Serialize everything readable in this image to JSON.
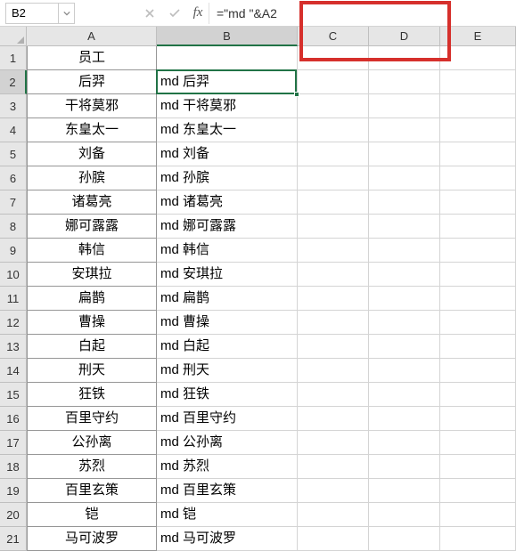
{
  "nameBox": {
    "value": "B2"
  },
  "formulaBar": {
    "fx_label": "fx",
    "formula": "=\"md \"&A2"
  },
  "columns": [
    "A",
    "B",
    "C",
    "D",
    "E"
  ],
  "selected": {
    "col": "B",
    "row": 2
  },
  "rows": [
    {
      "n": 1,
      "a": "员工",
      "b": ""
    },
    {
      "n": 2,
      "a": "后羿",
      "b": "md 后羿"
    },
    {
      "n": 3,
      "a": "干将莫邪",
      "b": "md 干将莫邪"
    },
    {
      "n": 4,
      "a": "东皇太一",
      "b": "md 东皇太一"
    },
    {
      "n": 5,
      "a": "刘备",
      "b": "md 刘备"
    },
    {
      "n": 6,
      "a": "孙膑",
      "b": "md 孙膑"
    },
    {
      "n": 7,
      "a": "诸葛亮",
      "b": "md 诸葛亮"
    },
    {
      "n": 8,
      "a": "娜可露露",
      "b": "md 娜可露露"
    },
    {
      "n": 9,
      "a": "韩信",
      "b": "md 韩信"
    },
    {
      "n": 10,
      "a": "安琪拉",
      "b": "md 安琪拉"
    },
    {
      "n": 11,
      "a": "扁鹊",
      "b": "md 扁鹊"
    },
    {
      "n": 12,
      "a": "曹操",
      "b": "md 曹操"
    },
    {
      "n": 13,
      "a": "白起",
      "b": "md 白起"
    },
    {
      "n": 14,
      "a": "刑天",
      "b": "md 刑天"
    },
    {
      "n": 15,
      "a": "狂铁",
      "b": "md 狂铁"
    },
    {
      "n": 16,
      "a": "百里守约",
      "b": "md 百里守约"
    },
    {
      "n": 17,
      "a": "公孙离",
      "b": "md 公孙离"
    },
    {
      "n": 18,
      "a": "苏烈",
      "b": "md 苏烈"
    },
    {
      "n": 19,
      "a": "百里玄策",
      "b": "md 百里玄策"
    },
    {
      "n": 20,
      "a": "铠",
      "b": "md 铠"
    },
    {
      "n": 21,
      "a": "马可波罗",
      "b": "md 马可波罗"
    }
  ]
}
